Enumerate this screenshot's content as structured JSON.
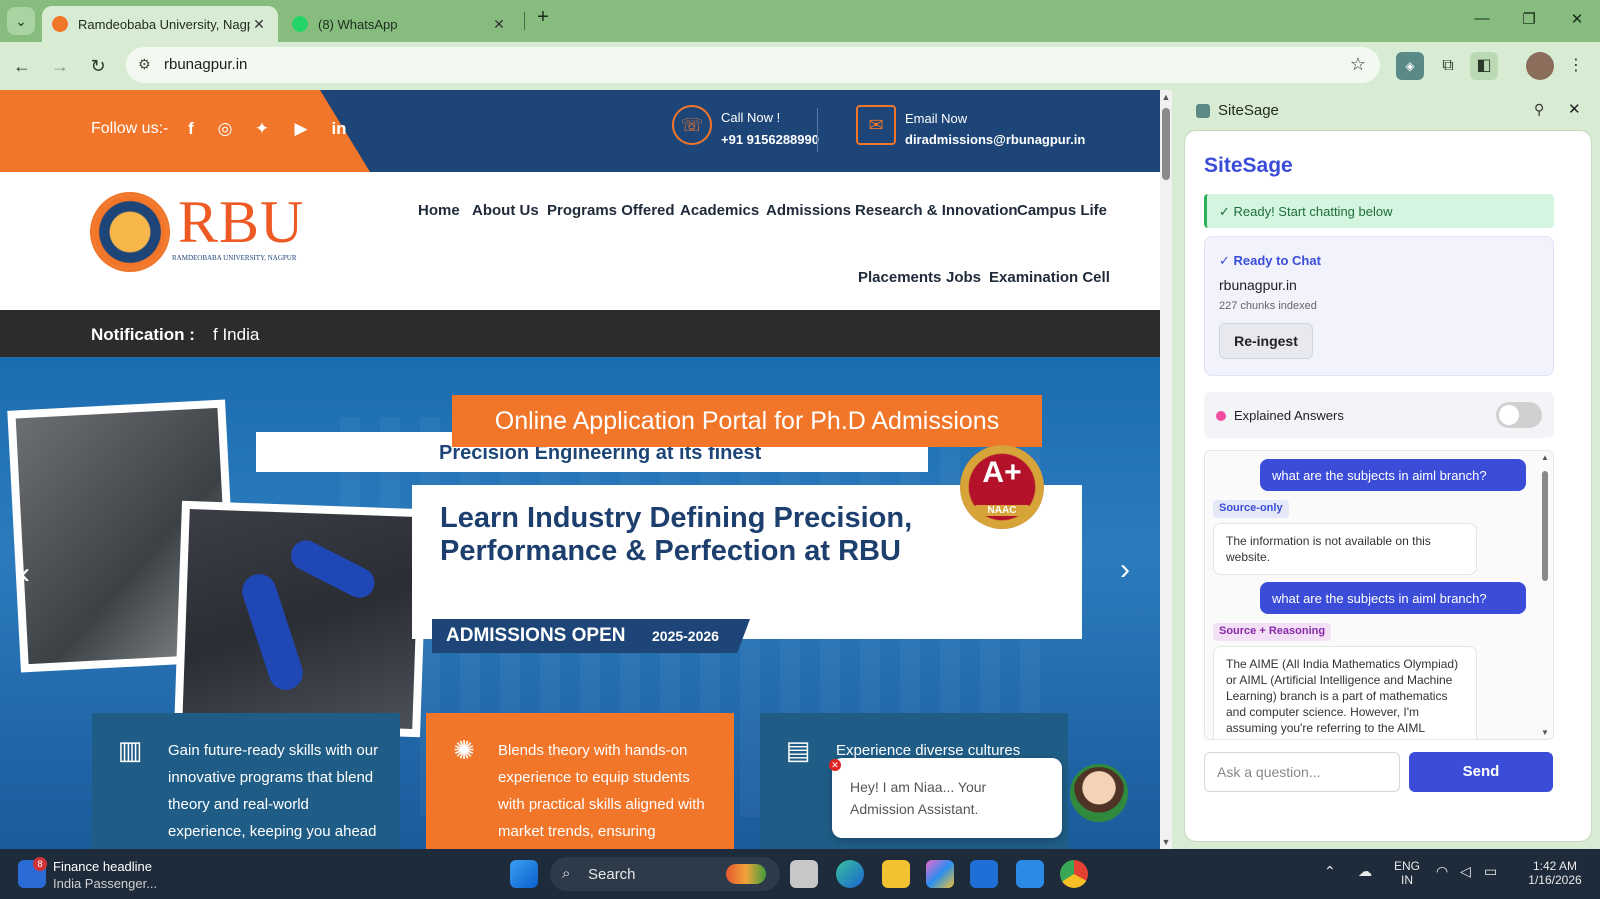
{
  "browser": {
    "tabs": [
      {
        "title": "Ramdeobaba University, Nagpu",
        "active": true
      },
      {
        "title": "(8) WhatsApp",
        "active": false
      }
    ],
    "url": "rbunagpur.in"
  },
  "site": {
    "follow_label": "Follow us:-",
    "social_icons": [
      "facebook-icon",
      "instagram-icon",
      "twitter-icon",
      "youtube-icon",
      "linkedin-icon"
    ],
    "call_label": "Call Now !",
    "phone": "+91 9156288990",
    "email_label": "Email Now",
    "email": "diradmissions@rbunagpur.in",
    "logo_text": "RBU",
    "logo_sub": "RAMDEOBABA UNIVERSITY, NAGPUR",
    "menu": [
      "Home",
      "About Us",
      "Programs Offered",
      "Academics",
      "Admissions",
      "Research & Innovation",
      "Campus Life",
      "Placements",
      "Jobs",
      "Examination Cell"
    ],
    "notification_label": "Notification :",
    "notification_text": "f India",
    "portal_button": "Online Application Portal for Ph.D Admissions",
    "tagline": "Precision Engineering at its finest",
    "hero_heading": "Learn Industry Defining Precision, Performance & Perfection at RBU",
    "admissions": "ADMISSIONS OPEN",
    "admissions_year": "2025-2026",
    "naac_grade": "A+",
    "naac_label": "NAAC",
    "features": [
      "Gain future-ready skills with our innovative programs that blend theory and real-world experience, keeping you ahead",
      "Blends theory with hands-on experience to equip students with practical skills aligned with market trends, ensuring",
      "Experience diverse cultures"
    ],
    "chatbot_greeting": "Hey! I am Niaa... Your Admission Assistant."
  },
  "sidepanel": {
    "header_title": "SiteSage",
    "title": "SiteSage",
    "ready_banner": "✓ Ready! Start chatting below",
    "ready_heading": "✓ Ready to Chat",
    "site": "rbunagpur.in",
    "chunks": "227 chunks indexed",
    "reingest": "Re-ingest",
    "explained_label": "Explained Answers",
    "explained_on": false,
    "messages": [
      {
        "role": "user",
        "text": "what are the subjects in aiml branch?"
      },
      {
        "role": "badge",
        "text": "Source-only"
      },
      {
        "role": "bot",
        "text": "The information is not available on this website."
      },
      {
        "role": "user",
        "text": "what are the subjects in aiml branch?"
      },
      {
        "role": "badge",
        "text": "Source + Reasoning"
      },
      {
        "role": "bot",
        "text": "The AIME (All India Mathematics Olympiad) or AIML (Artificial Intelligence and Machine Learning) branch is a part of mathematics and computer science. However, I'm assuming you're referring to the AIML"
      }
    ],
    "input_placeholder": "Ask a question...",
    "send": "Send"
  },
  "taskbar": {
    "news_title": "Finance headline",
    "news_sub": "India Passenger...",
    "news_badge": "8",
    "search": "Search",
    "lang": "ENG",
    "region": "IN",
    "time": "1:42 AM",
    "date": "1/16/2026"
  },
  "colors": {
    "accent": "#3b4dd8",
    "brand_orange": "#f2762a",
    "brand_navy": "#1d4577"
  }
}
